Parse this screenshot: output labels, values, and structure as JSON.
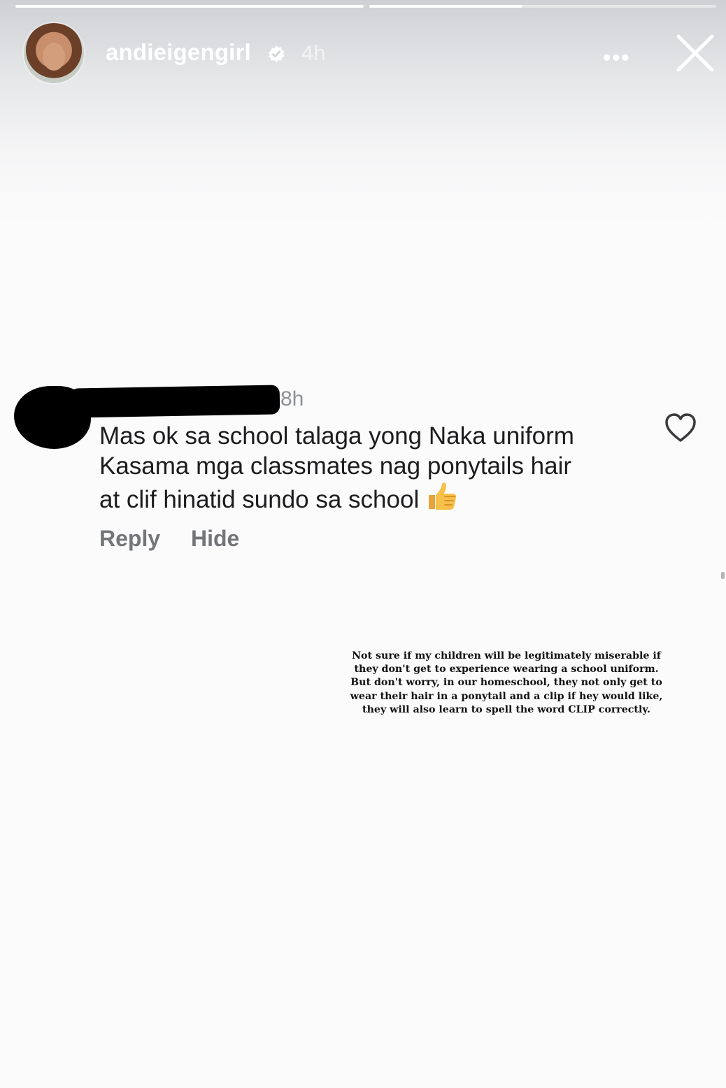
{
  "story": {
    "progress": [
      1.0,
      0.44
    ],
    "username": "andieigengirl",
    "time": "4h",
    "more_label": "•••"
  },
  "comment": {
    "time": "8h",
    "lines": [
      "Mas ok sa school talaga yong Naka uniform",
      "Kasama mga classmates nag ponytails hair",
      "at clif hinatid sundo sa school"
    ],
    "emoji": "thumbs-up",
    "reply_label": "Reply",
    "hide_label": "Hide"
  },
  "caption": {
    "lines": [
      "Not sure if my children will be legitimately miserable if",
      "they don't get to experience wearing a school uniform.",
      "But don't worry, in our homeschool, they not only get to",
      "wear their hair in a ponytail and a clip if hey would like,",
      "they will also learn to spell the word CLIP correctly."
    ]
  },
  "icons": {
    "verified": "verified-badge-icon",
    "close": "close-icon",
    "heart": "heart-icon",
    "thumb": "thumbs-up-icon"
  }
}
